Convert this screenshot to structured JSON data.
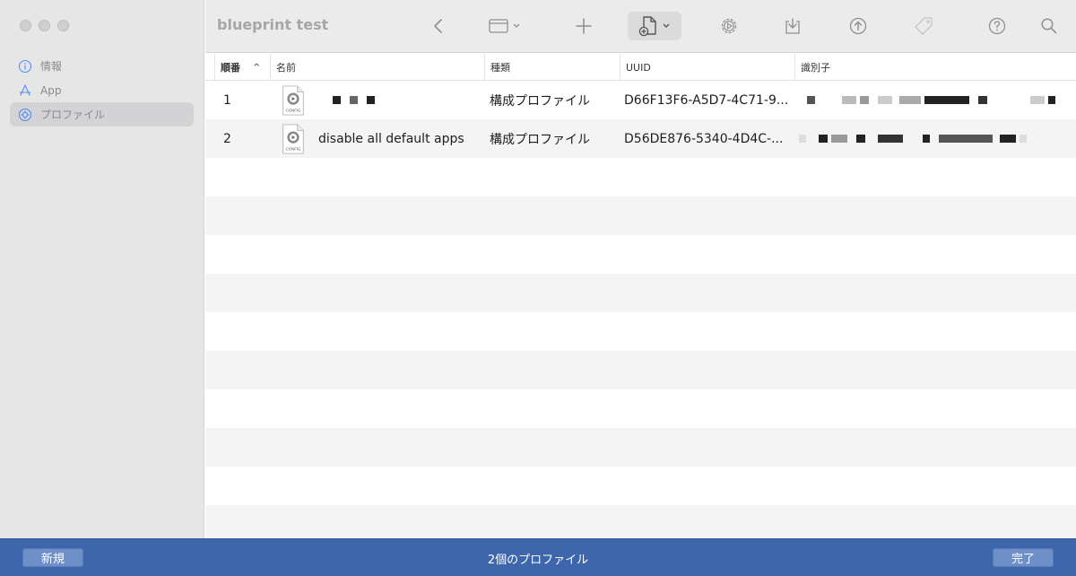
{
  "window": {
    "title": "blueprint test"
  },
  "sidebar": {
    "items": [
      {
        "label": "情報",
        "icon": "info-icon",
        "active": false
      },
      {
        "label": "App",
        "icon": "app-store-icon",
        "active": false
      },
      {
        "label": "プロファイル",
        "icon": "profile-gear-icon",
        "active": true
      }
    ]
  },
  "toolbar": {
    "buttons": [
      {
        "name": "back-button",
        "icon": "chevron-left-icon"
      },
      {
        "name": "view-menu-button",
        "icon": "window-icon"
      },
      {
        "name": "add-button",
        "icon": "plus-icon"
      },
      {
        "name": "add-document-button",
        "icon": "document-plus-icon"
      },
      {
        "name": "settings-button",
        "icon": "gear-icon"
      },
      {
        "name": "download-button",
        "icon": "download-tray-icon"
      },
      {
        "name": "upload-button",
        "icon": "upload-circle-icon"
      },
      {
        "name": "tag-button",
        "icon": "tag-icon"
      },
      {
        "name": "help-button",
        "icon": "question-icon"
      },
      {
        "name": "search-button",
        "icon": "search-icon"
      }
    ]
  },
  "table": {
    "columns": [
      {
        "key": "order",
        "label": "順番"
      },
      {
        "key": "name",
        "label": "名前"
      },
      {
        "key": "type",
        "label": "種類"
      },
      {
        "key": "uuid",
        "label": "UUID"
      },
      {
        "key": "identifier",
        "label": "識別子"
      }
    ],
    "rows": [
      {
        "order": "1",
        "name": "",
        "type": "構成プロファイル",
        "uuid": "D66F13F6-A5D7-4C71-9...",
        "icon_label": "CONFIG"
      },
      {
        "order": "2",
        "name": "disable all default apps",
        "type": "構成プロファイル",
        "uuid": "D56DE876-5340-4D4C-...",
        "icon_label": "CONFIG"
      }
    ]
  },
  "bottom": {
    "new_label": "新規",
    "status": "2個のプロファイル",
    "done_label": "完了"
  },
  "colors": {
    "accent": "#3e66ac",
    "sidebar_icon": "#4f8ef7"
  }
}
